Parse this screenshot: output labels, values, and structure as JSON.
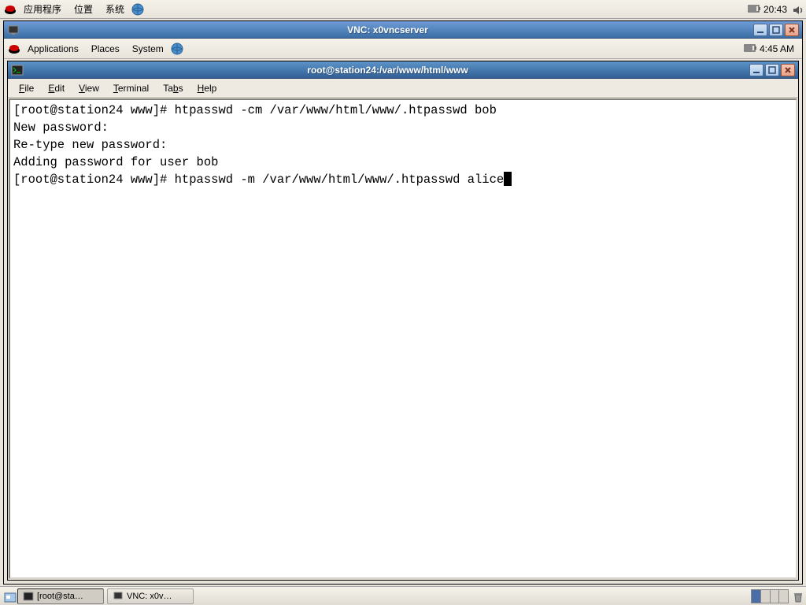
{
  "outer_panel": {
    "menu_applications": "应用程序",
    "menu_places": "位置",
    "menu_system": "系统",
    "time": "20:43"
  },
  "vnc_window": {
    "title": "VNC: x0vncserver"
  },
  "inner_panel": {
    "menu_applications": "Applications",
    "menu_places": "Places",
    "menu_system": "System",
    "time": "4:45 AM"
  },
  "terminal_window": {
    "title": "root@station24:/var/www/html/www",
    "menu": {
      "file": "File",
      "edit": "Edit",
      "view": "View",
      "terminal": "Terminal",
      "tabs": "Tabs",
      "help": "Help"
    },
    "lines": [
      "[root@station24 www]# htpasswd -cm /var/www/html/www/.htpasswd bob",
      "New password: ",
      "Re-type new password: ",
      "Adding password for user bob",
      "[root@station24 www]# htpasswd -m /var/www/html/www/.htpasswd alice"
    ]
  },
  "taskbar": {
    "btn1": "[root@sta…",
    "btn2": "VNC: x0v…"
  }
}
